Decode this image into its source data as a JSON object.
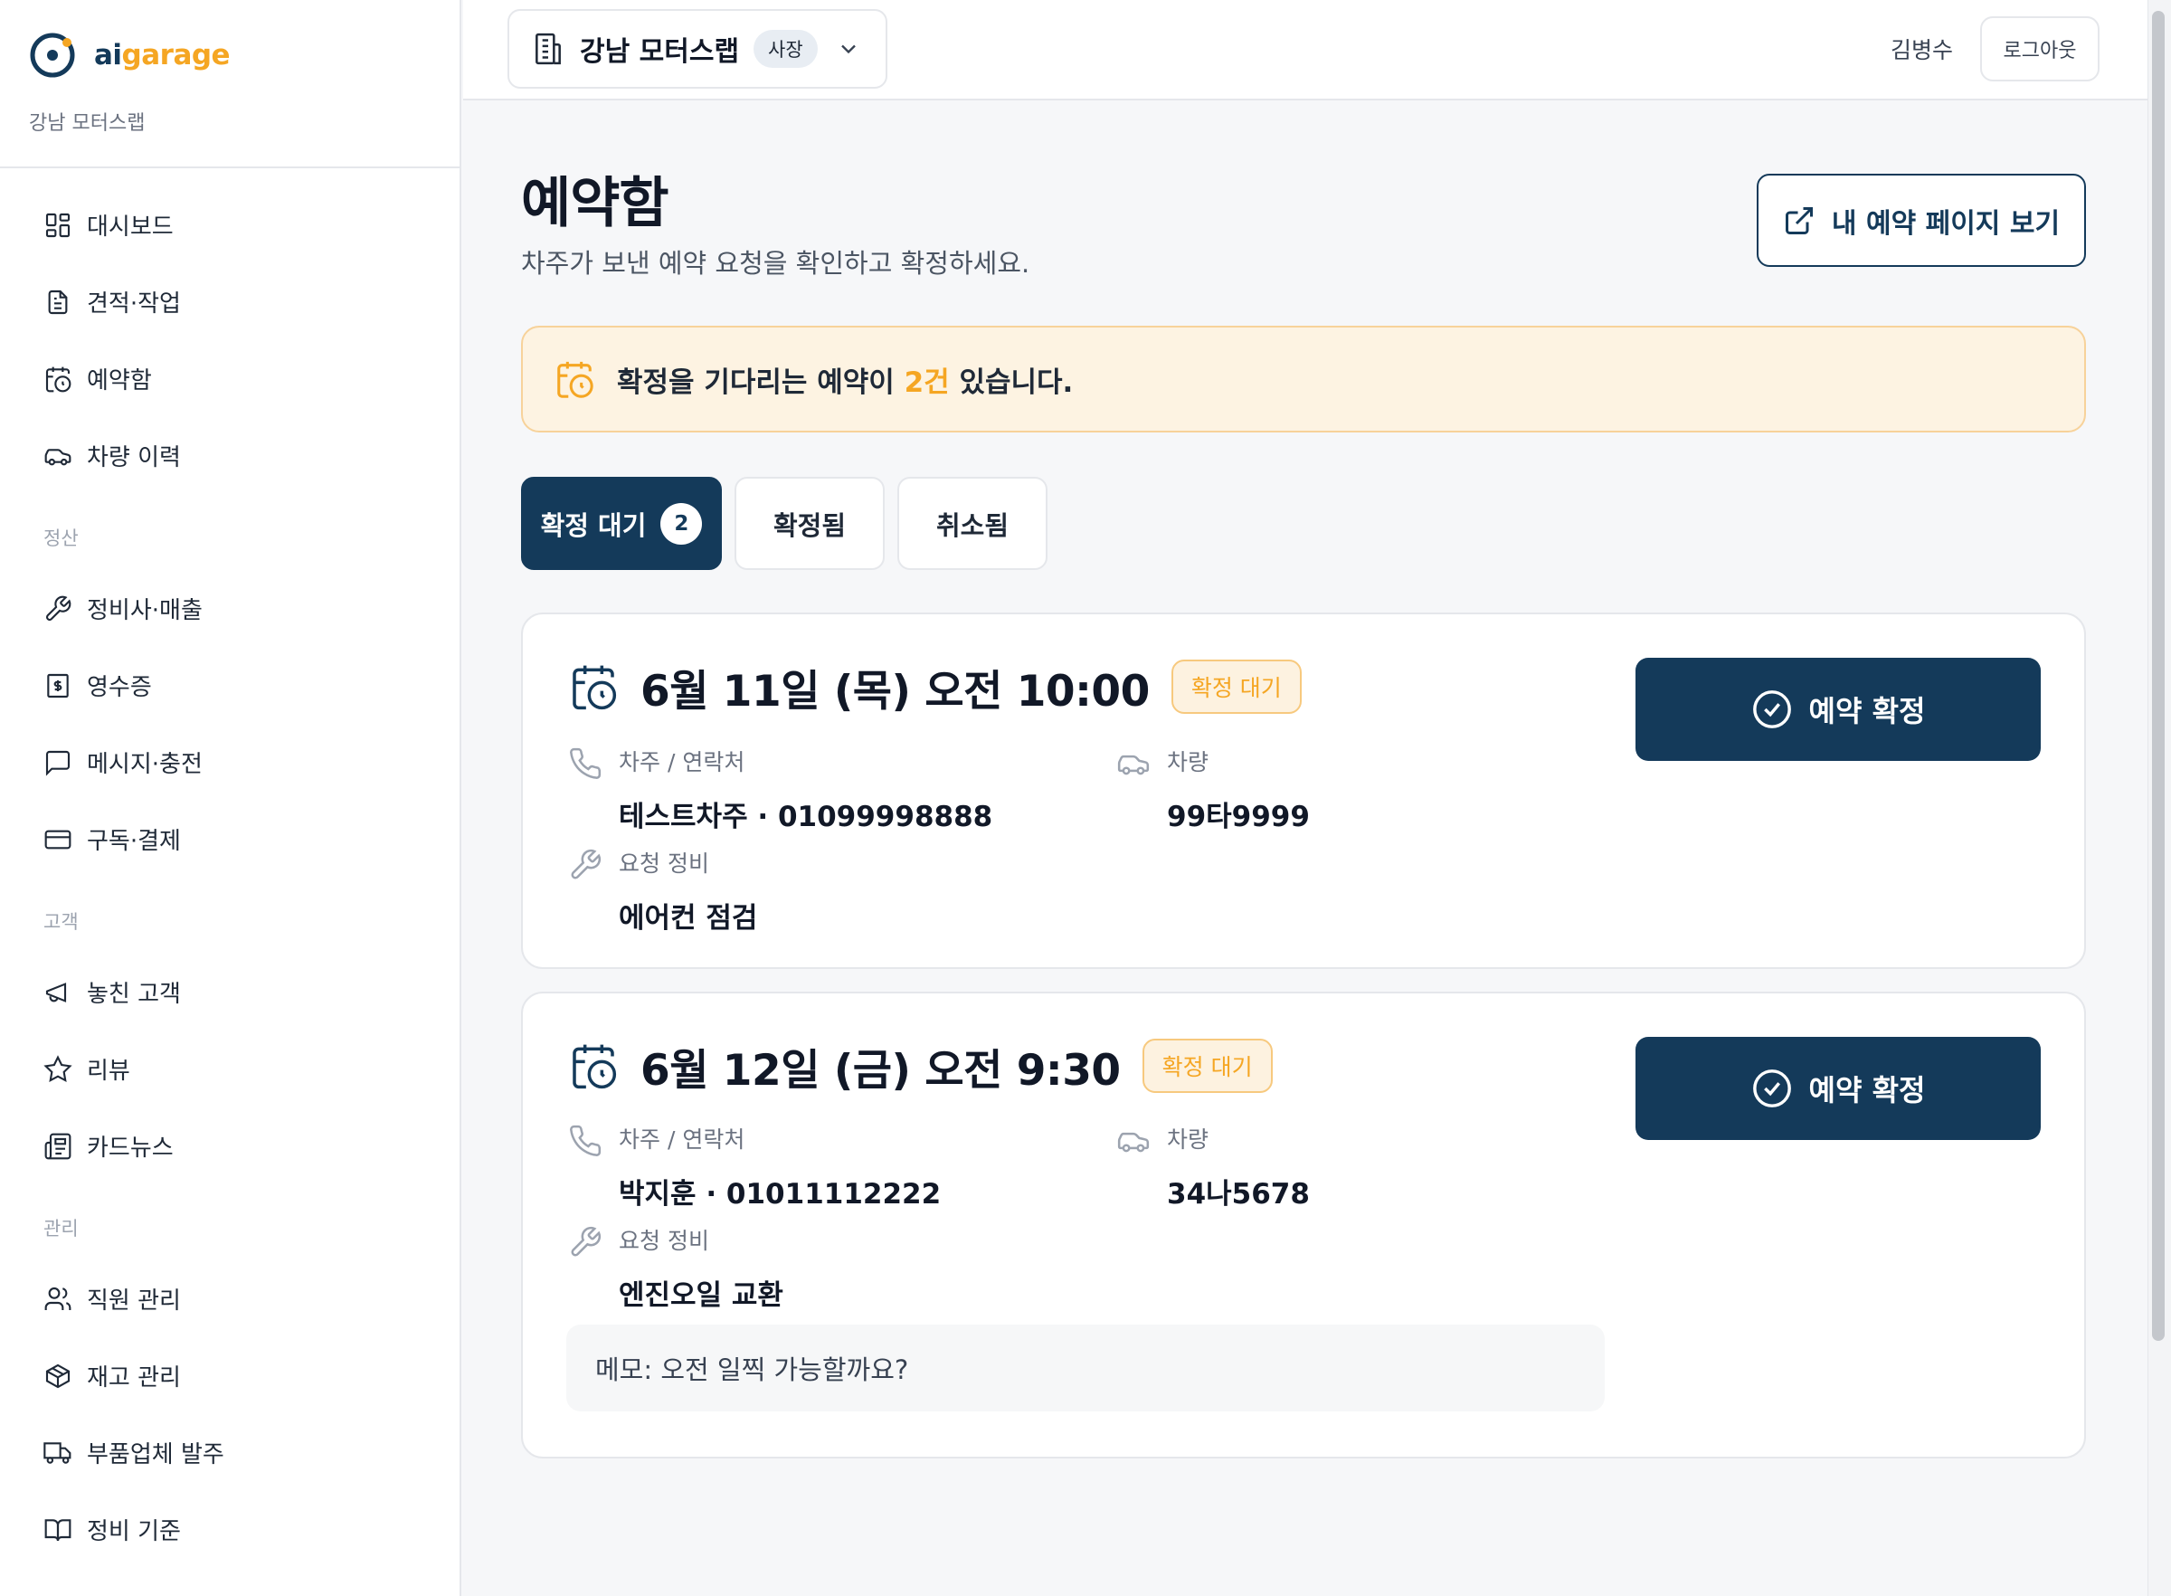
{
  "brand": {
    "ai": "ai",
    "garage": "garage"
  },
  "sidebar": {
    "shop_name": "강남 모터스랩",
    "items": [
      {
        "label": "대시보드",
        "icon": "dashboard-icon"
      },
      {
        "label": "견적·작업",
        "icon": "document-icon"
      },
      {
        "label": "예약함",
        "icon": "calendar-clock-icon"
      },
      {
        "label": "차량 이력",
        "icon": "car-icon"
      }
    ],
    "sections": [
      {
        "title": "정산",
        "items": [
          {
            "label": "정비사·매출",
            "icon": "wrench-icon"
          },
          {
            "label": "영수증",
            "icon": "receipt-icon"
          },
          {
            "label": "메시지·충전",
            "icon": "message-icon"
          },
          {
            "label": "구독·결제",
            "icon": "credit-card-icon"
          }
        ]
      },
      {
        "title": "고객",
        "items": [
          {
            "label": "놓친 고객",
            "icon": "megaphone-icon"
          },
          {
            "label": "리뷰",
            "icon": "star-icon"
          },
          {
            "label": "카드뉴스",
            "icon": "newspaper-icon"
          }
        ]
      },
      {
        "title": "관리",
        "items": [
          {
            "label": "직원 관리",
            "icon": "users-icon"
          },
          {
            "label": "재고 관리",
            "icon": "box-icon"
          },
          {
            "label": "부품업체 발주",
            "icon": "truck-icon"
          },
          {
            "label": "정비 기준",
            "icon": "book-icon"
          }
        ]
      }
    ]
  },
  "topbar": {
    "shop_name": "강남 모터스랩",
    "role": "사장",
    "user_name": "김병수",
    "logout_label": "로그아웃"
  },
  "page": {
    "title": "예약함",
    "subtitle": "차주가 보낸 예약 요청을 확인하고 확정하세요.",
    "view_page_label": "내 예약 페이지 보기"
  },
  "notice": {
    "before": "확정을 기다리는 예약이 ",
    "count": "2건",
    "after": " 있습니다."
  },
  "tabs": [
    {
      "label": "확정 대기",
      "count": "2"
    },
    {
      "label": "확정됨"
    },
    {
      "label": "취소됨"
    }
  ],
  "labels": {
    "owner_contact": "차주 / 연락처",
    "vehicle": "차량",
    "service": "요청 정비",
    "confirm": "예약 확정"
  },
  "reservations": [
    {
      "datetime": "6월 11일 (목) 오전 10:00",
      "status": "확정 대기",
      "owner_contact": "테스트차주 · 01099998888",
      "vehicle": "99타9999",
      "service": "에어컨 점검",
      "memo": ""
    },
    {
      "datetime": "6월 12일 (금) 오전 9:30",
      "status": "확정 대기",
      "owner_contact": "박지훈 · 01011112222",
      "vehicle": "34나5678",
      "service": "엔진오일 교환",
      "memo": "메모: 오전 일찍 가능할까요?"
    }
  ],
  "colors": {
    "primary": "#143a5a",
    "accent": "#f5a623",
    "notice_bg": "#fdf3e2",
    "page_bg": "#f6f7f9"
  }
}
